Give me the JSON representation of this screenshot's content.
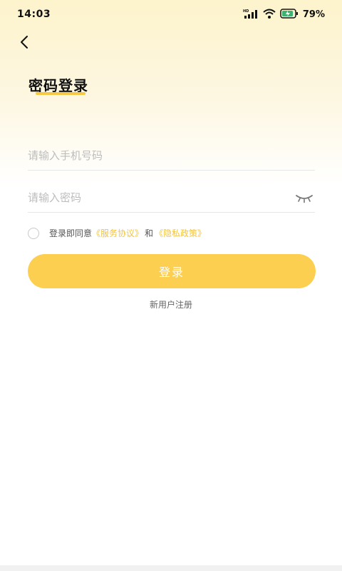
{
  "status_bar": {
    "time": "14:03",
    "network_badge": "HD",
    "battery": "79%",
    "icons": [
      "signal-icon",
      "wifi-icon",
      "battery-icon"
    ]
  },
  "header": {
    "back_icon": "chevron-left-icon",
    "title": "密码登录"
  },
  "form": {
    "phone_placeholder": "请输入手机号码",
    "phone_value": "",
    "password_placeholder": "请输入密码",
    "password_value": "",
    "password_toggle_icon": "eye-closed-icon"
  },
  "agreement": {
    "prefix": "登录即同意",
    "service_link": "《服务协议》",
    "conjunction": "和",
    "privacy_link": "《隐私政策》",
    "checked": false
  },
  "actions": {
    "login_label": "登录",
    "register_label": "新用户注册"
  },
  "colors": {
    "accent": "#fccf50",
    "link": "#f2c440",
    "underline": "#f7c846"
  }
}
